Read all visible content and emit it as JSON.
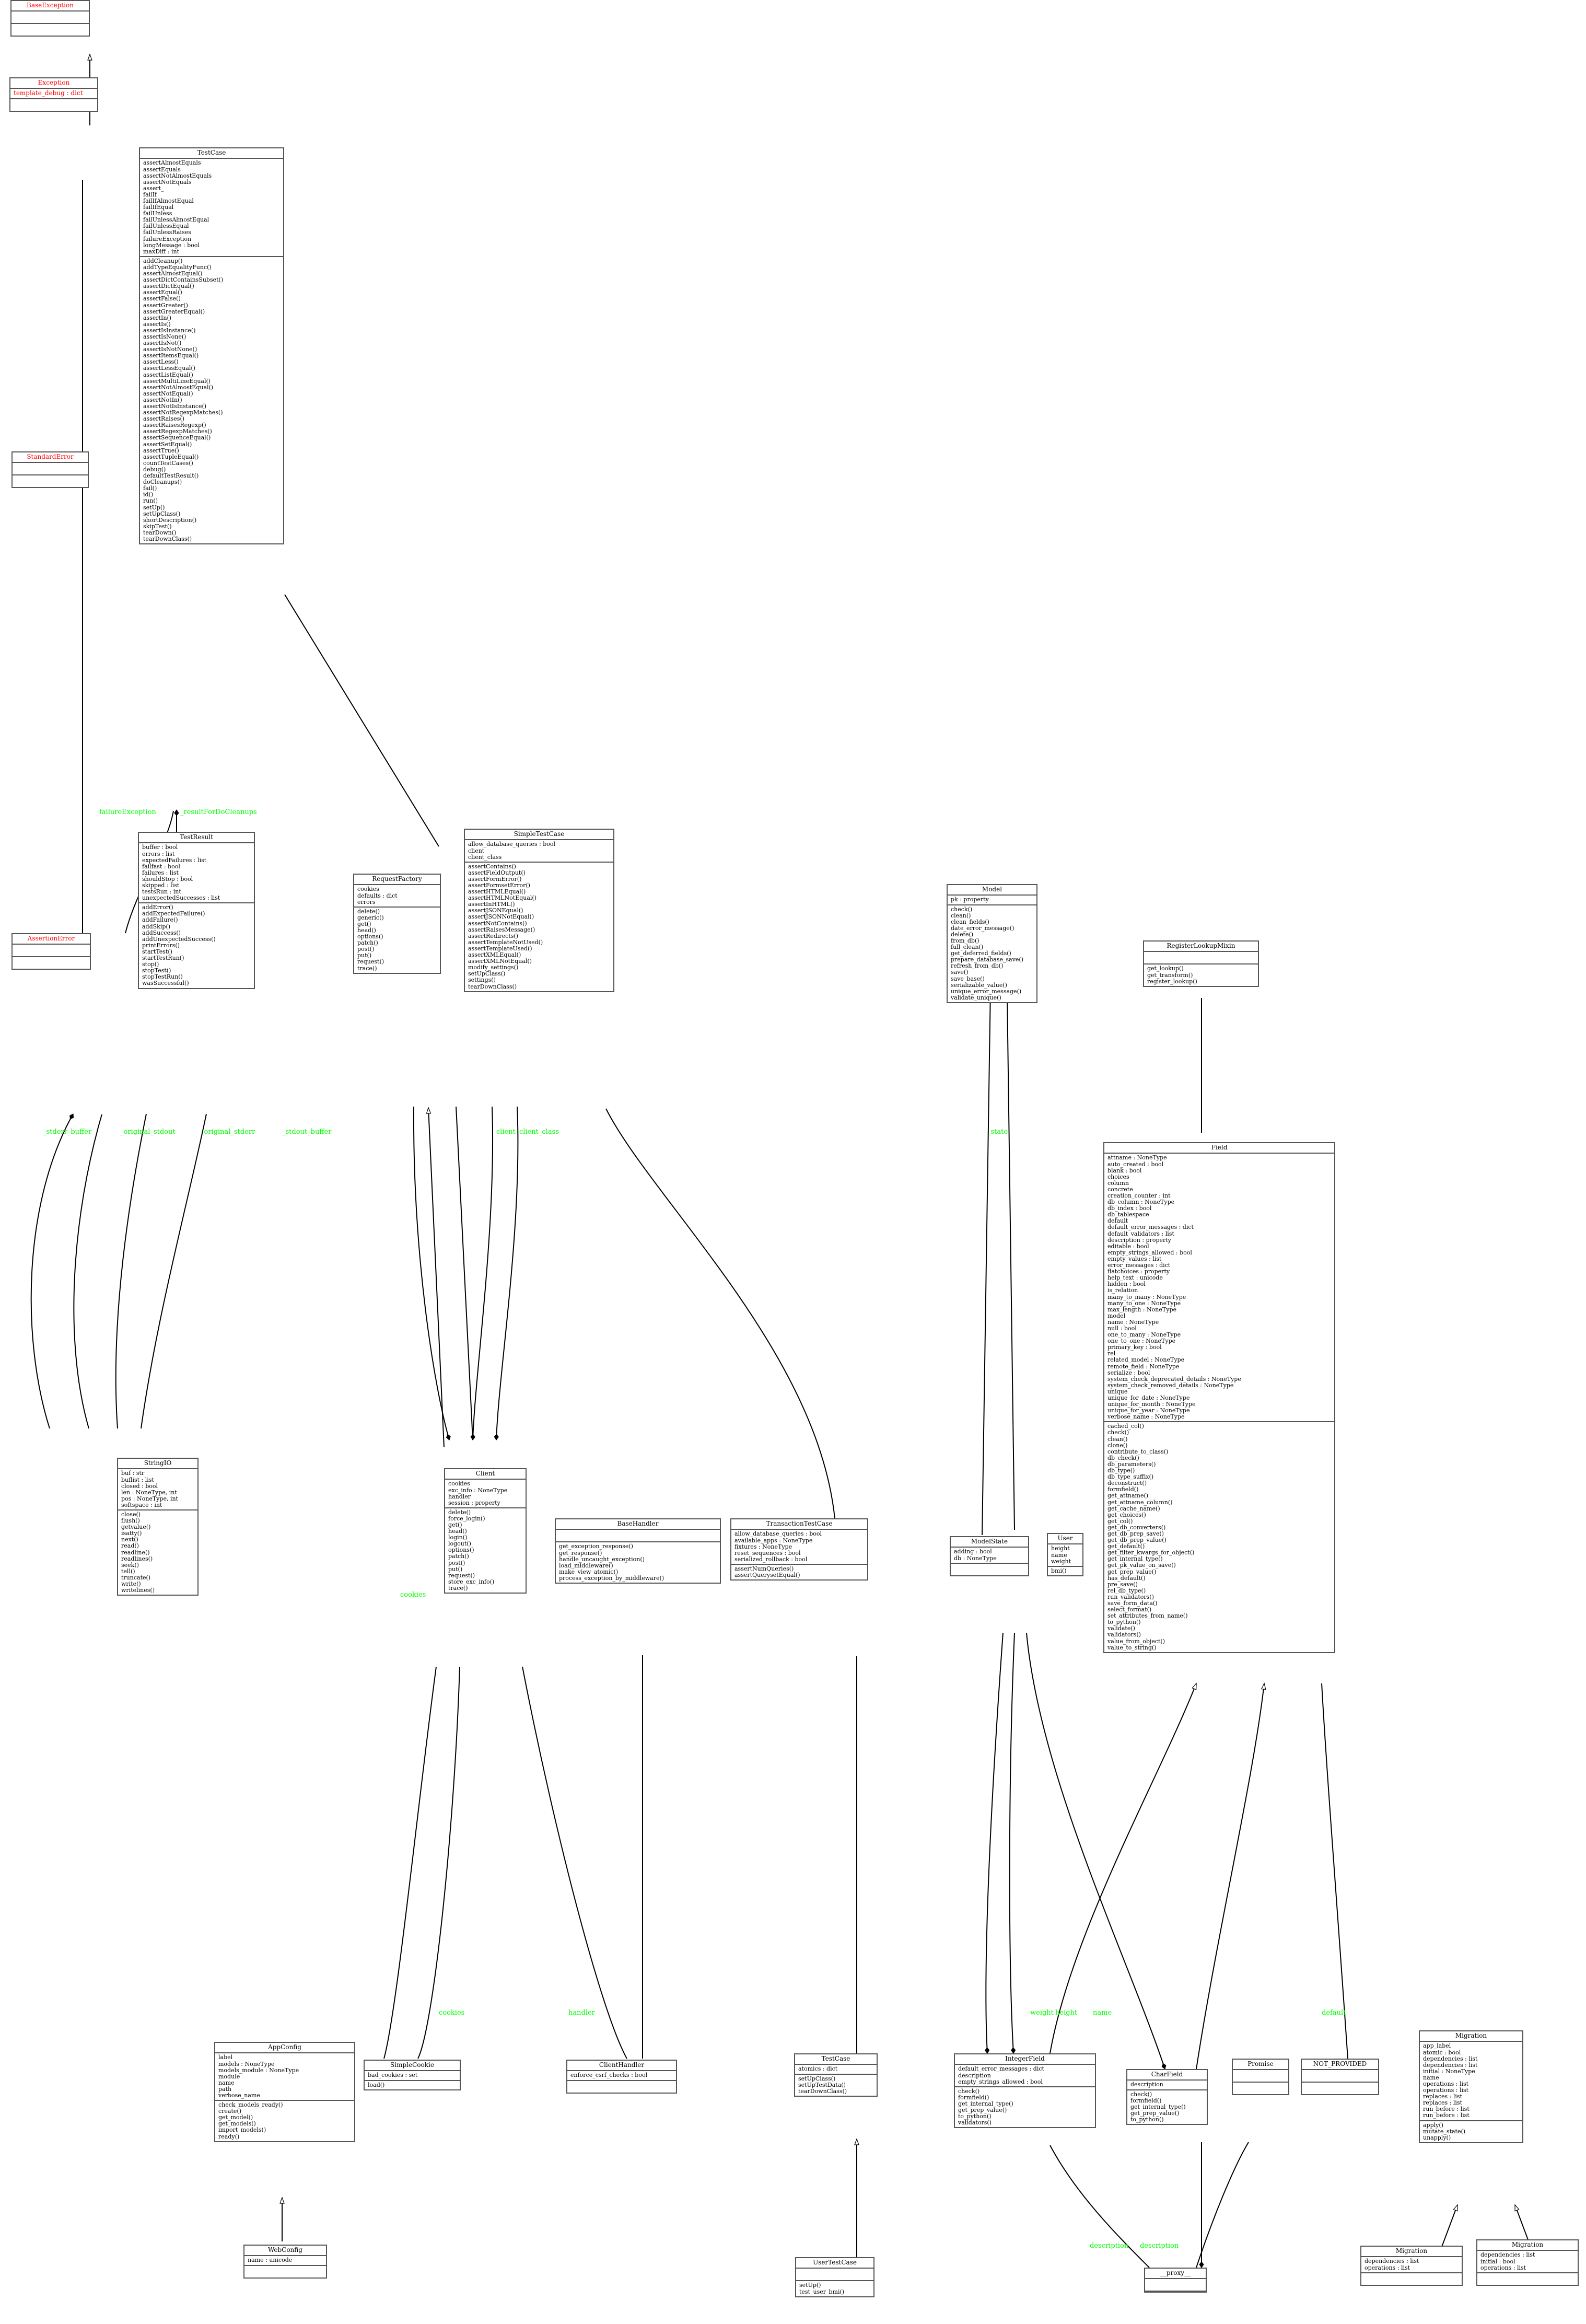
{
  "diagram": {
    "kind": "uml-class-diagram",
    "colors": {
      "box_border": "#555555",
      "box_fill": "#ffffff",
      "edge": "#000000",
      "edge_label": "#00ff00",
      "exception_text": "#ff0000"
    }
  },
  "classes": {
    "base_exception": {
      "name": "BaseException",
      "attrs": [],
      "ops": []
    },
    "exception": {
      "name": "Exception",
      "attrs": [
        "template_debug : dict"
      ],
      "ops": []
    },
    "standard_error": {
      "name": "StandardError",
      "attrs": [],
      "ops": []
    },
    "assertion_error": {
      "name": "AssertionError",
      "attrs": [],
      "ops": []
    },
    "testcase_unittest": {
      "name": "TestCase",
      "attrs": [
        "assertAlmostEquals",
        "assertEquals",
        "assertNotAlmostEquals",
        "assertNotEquals",
        "assert_",
        "failIf",
        "failIfAlmostEqual",
        "failIfEqual",
        "failUnless",
        "failUnlessAlmostEqual",
        "failUnlessEqual",
        "failUnlessRaises",
        "failureException",
        "longMessage : bool",
        "maxDiff : int"
      ],
      "ops": [
        "addCleanup()",
        "addTypeEqualityFunc()",
        "assertAlmostEqual()",
        "assertDictContainsSubset()",
        "assertDictEqual()",
        "assertEqual()",
        "assertFalse()",
        "assertGreater()",
        "assertGreaterEqual()",
        "assertIn()",
        "assertIs()",
        "assertIsInstance()",
        "assertIsNone()",
        "assertIsNot()",
        "assertIsNotNone()",
        "assertItemsEqual()",
        "assertLess()",
        "assertLessEqual()",
        "assertListEqual()",
        "assertMultiLineEqual()",
        "assertNotAlmostEqual()",
        "assertNotEqual()",
        "assertNotIn()",
        "assertNotIsInstance()",
        "assertNotRegexpMatches()",
        "assertRaises()",
        "assertRaisesRegexp()",
        "assertRegexpMatches()",
        "assertSequenceEqual()",
        "assertSetEqual()",
        "assertTrue()",
        "assertTupleEqual()",
        "countTestCases()",
        "debug()",
        "defaultTestResult()",
        "doCleanups()",
        "fail()",
        "id()",
        "run()",
        "setUp()",
        "setUpClass()",
        "shortDescription()",
        "skipTest()",
        "tearDown()",
        "tearDownClass()"
      ]
    },
    "test_result": {
      "name": "TestResult",
      "attrs": [
        "buffer : bool",
        "errors : list",
        "expectedFailures : list",
        "failfast : bool",
        "failures : list",
        "shouldStop : bool",
        "skipped : list",
        "testsRun : int",
        "unexpectedSuccesses : list"
      ],
      "ops": [
        "addError()",
        "addExpectedFailure()",
        "addFailure()",
        "addSkip()",
        "addSuccess()",
        "addUnexpectedSuccess()",
        "printErrors()",
        "startTest()",
        "startTestRun()",
        "stop()",
        "stopTest()",
        "stopTestRun()",
        "wasSuccessful()"
      ]
    },
    "request_factory": {
      "name": "RequestFactory",
      "attrs": [
        "cookies",
        "defaults : dict",
        "errors"
      ],
      "ops": [
        "delete()",
        "generic()",
        "get()",
        "head()",
        "options()",
        "patch()",
        "post()",
        "put()",
        "request()",
        "trace()"
      ]
    },
    "simple_test_case": {
      "name": "SimpleTestCase",
      "attrs": [
        "allow_database_queries : bool",
        "client",
        "client_class"
      ],
      "ops": [
        "assertContains()",
        "assertFieldOutput()",
        "assertFormError()",
        "assertFormsetError()",
        "assertHTMLEqual()",
        "assertHTMLNotEqual()",
        "assertInHTML()",
        "assertJSONEqual()",
        "assertJSONNotEqual()",
        "assertNotContains()",
        "assertRaisesMessage()",
        "assertRedirects()",
        "assertTemplateNotUsed()",
        "assertTemplateUsed()",
        "assertXMLEqual()",
        "assertXMLNotEqual()",
        "modify_settings()",
        "setUpClass()",
        "settings()",
        "tearDownClass()"
      ]
    },
    "model": {
      "name": "Model",
      "attrs": [
        "pk : property"
      ],
      "ops": [
        "check()",
        "clean()",
        "clean_fields()",
        "date_error_message()",
        "delete()",
        "from_db()",
        "full_clean()",
        "get_deferred_fields()",
        "prepare_database_save()",
        "refresh_from_db()",
        "save()",
        "save_base()",
        "serializable_value()",
        "unique_error_message()",
        "validate_unique()"
      ]
    },
    "register_lookup_mixin": {
      "name": "RegisterLookupMixin",
      "attrs": [],
      "ops": [
        "get_lookup()",
        "get_transform()",
        "register_lookup()"
      ]
    },
    "field": {
      "name": "Field",
      "attrs": [
        "attname : NoneType",
        "auto_created : bool",
        "blank : bool",
        "choices",
        "column",
        "concrete",
        "creation_counter : int",
        "db_column : NoneType",
        "db_index : bool",
        "db_tablespace",
        "default",
        "default_error_messages : dict",
        "default_validators : list",
        "description : property",
        "editable : bool",
        "empty_strings_allowed : bool",
        "empty_values : list",
        "error_messages : dict",
        "flatchoices : property",
        "help_text : unicode",
        "hidden : bool",
        "is_relation",
        "many_to_many : NoneType",
        "many_to_one : NoneType",
        "max_length : NoneType",
        "model",
        "name : NoneType",
        "null : bool",
        "one_to_many : NoneType",
        "one_to_one : NoneType",
        "primary_key : bool",
        "rel",
        "related_model : NoneType",
        "remote_field : NoneType",
        "serialize : bool",
        "system_check_deprecated_details : NoneType",
        "system_check_removed_details : NoneType",
        "unique",
        "unique_for_date : NoneType",
        "unique_for_month : NoneType",
        "unique_for_year : NoneType",
        "verbose_name : NoneType"
      ],
      "ops": [
        "cached_col()",
        "check()",
        "clean()",
        "clone()",
        "contribute_to_class()",
        "db_check()",
        "db_parameters()",
        "db_type()",
        "db_type_suffix()",
        "deconstruct()",
        "formfield()",
        "get_attname()",
        "get_attname_column()",
        "get_cache_name()",
        "get_choices()",
        "get_col()",
        "get_db_converters()",
        "get_db_prep_save()",
        "get_db_prep_value()",
        "get_default()",
        "get_filter_kwargs_for_object()",
        "get_internal_type()",
        "get_pk_value_on_save()",
        "get_prep_value()",
        "has_default()",
        "pre_save()",
        "rel_db_type()",
        "run_validators()",
        "save_form_data()",
        "select_format()",
        "set_attributes_from_name()",
        "to_python()",
        "validate()",
        "validators()",
        "value_from_object()",
        "value_to_string()"
      ]
    },
    "string_io": {
      "name": "StringIO",
      "attrs": [
        "buf : str",
        "buflist : list",
        "closed : bool",
        "len : NoneType, int",
        "pos : NoneType, int",
        "softspace : int"
      ],
      "ops": [
        "close()",
        "flush()",
        "getvalue()",
        "isatty()",
        "next()",
        "read()",
        "readline()",
        "readlines()",
        "seek()",
        "tell()",
        "truncate()",
        "write()",
        "writelines()"
      ]
    },
    "client": {
      "name": "Client",
      "attrs": [
        "cookies",
        "exc_info : NoneType",
        "handler",
        "session : property"
      ],
      "ops": [
        "delete()",
        "force_login()",
        "get()",
        "head()",
        "login()",
        "logout()",
        "options()",
        "patch()",
        "post()",
        "put()",
        "request()",
        "store_exc_info()",
        "trace()"
      ]
    },
    "base_handler": {
      "name": "BaseHandler",
      "attrs": [],
      "ops": [
        "get_exception_response()",
        "get_response()",
        "handle_uncaught_exception()",
        "load_middleware()",
        "make_view_atomic()",
        "process_exception_by_middleware()"
      ]
    },
    "transaction_test_case": {
      "name": "TransactionTestCase",
      "attrs": [
        "allow_database_queries : bool",
        "available_apps : NoneType",
        "fixtures : NoneType",
        "reset_sequences : bool",
        "serialized_rollback : bool"
      ],
      "ops": [
        "assertNumQueries()",
        "assertQuerysetEqual()"
      ]
    },
    "model_state": {
      "name": "ModelState",
      "attrs": [
        "adding : bool",
        "db : NoneType"
      ],
      "ops": []
    },
    "user": {
      "name": "User",
      "attrs": [
        "height",
        "name",
        "weight"
      ],
      "ops": [
        "bmi()"
      ]
    },
    "app_config": {
      "name": "AppConfig",
      "attrs": [
        "label",
        "models : NoneType",
        "models_module : NoneType",
        "module",
        "name",
        "path",
        "verbose_name"
      ],
      "ops": [
        "check_models_ready()",
        "create()",
        "get_model()",
        "get_models()",
        "import_models()",
        "ready()"
      ]
    },
    "web_config": {
      "name": "WebConfig",
      "attrs": [
        "name : unicode"
      ],
      "ops": []
    },
    "simple_cookie": {
      "name": "SimpleCookie",
      "attrs": [
        "bad_cookies : set"
      ],
      "ops": [
        "load()"
      ]
    },
    "client_handler": {
      "name": "ClientHandler",
      "attrs": [
        "enforce_csrf_checks : bool"
      ],
      "ops": []
    },
    "testcase_django": {
      "name": "TestCase",
      "attrs": [
        "atomics : dict"
      ],
      "ops": [
        "setUpClass()",
        "setUpTestData()",
        "tearDownClass()"
      ]
    },
    "user_test_case": {
      "name": "UserTestCase",
      "attrs": [],
      "ops": [
        "setUp()",
        "test_user_bmi()"
      ]
    },
    "integer_field": {
      "name": "IntegerField",
      "attrs": [
        "default_error_messages : dict",
        "description",
        "empty_strings_allowed : bool"
      ],
      "ops": [
        "check()",
        "formfield()",
        "get_internal_type()",
        "get_prep_value()",
        "to_python()",
        "validators()"
      ]
    },
    "char_field": {
      "name": "CharField",
      "attrs": [
        "description"
      ],
      "ops": [
        "check()",
        "formfield()",
        "get_internal_type()",
        "get_prep_value()",
        "to_python()"
      ]
    },
    "promise": {
      "name": "Promise",
      "attrs": [],
      "ops": []
    },
    "not_provided": {
      "name": "NOT_PROVIDED",
      "attrs": [],
      "ops": []
    },
    "proxy": {
      "name": "__proxy__",
      "attrs": [],
      "ops": []
    },
    "migration_main": {
      "name": "Migration",
      "attrs": [
        "app_label",
        "atomic : bool",
        "dependencies : list",
        "dependencies : list",
        "initial : NoneType",
        "name",
        "operations : list",
        "operations : list",
        "replaces : list",
        "replaces : list",
        "run_before : list",
        "run_before : list"
      ],
      "ops": [
        "apply()",
        "mutate_state()",
        "unapply()"
      ]
    },
    "migration_sub_left": {
      "name": "Migration",
      "attrs": [
        "dependencies : list",
        "operations : list"
      ],
      "ops": []
    },
    "migration_sub_right": {
      "name": "Migration",
      "attrs": [
        "dependencies : list",
        "initial : bool",
        "operations : list"
      ],
      "ops": []
    }
  },
  "edge_labels": [
    {
      "id": "failure_exception",
      "text": "failureException"
    },
    {
      "id": "result_for_do_cleanups",
      "text": "_resultForDoCleanups"
    },
    {
      "id": "stderr_buffer",
      "text": "_stderr_buffer"
    },
    {
      "id": "original_stdout",
      "text": "_original_stdout"
    },
    {
      "id": "original_stderr",
      "text": "_original_stderr"
    },
    {
      "id": "stdout_buffer",
      "text": "_stdout_buffer"
    },
    {
      "id": "client",
      "text": "client"
    },
    {
      "id": "client_class",
      "text": "client_class"
    },
    {
      "id": "cookies_left",
      "text": "cookies"
    },
    {
      "id": "cookies_mid",
      "text": "cookies"
    },
    {
      "id": "handler",
      "text": "handler"
    },
    {
      "id": "state",
      "text": "_state"
    },
    {
      "id": "weight",
      "text": "weight"
    },
    {
      "id": "height",
      "text": "height"
    },
    {
      "id": "name",
      "text": "name"
    },
    {
      "id": "default",
      "text": "default"
    },
    {
      "id": "description_a",
      "text": "description"
    },
    {
      "id": "description_b",
      "text": "description"
    }
  ]
}
